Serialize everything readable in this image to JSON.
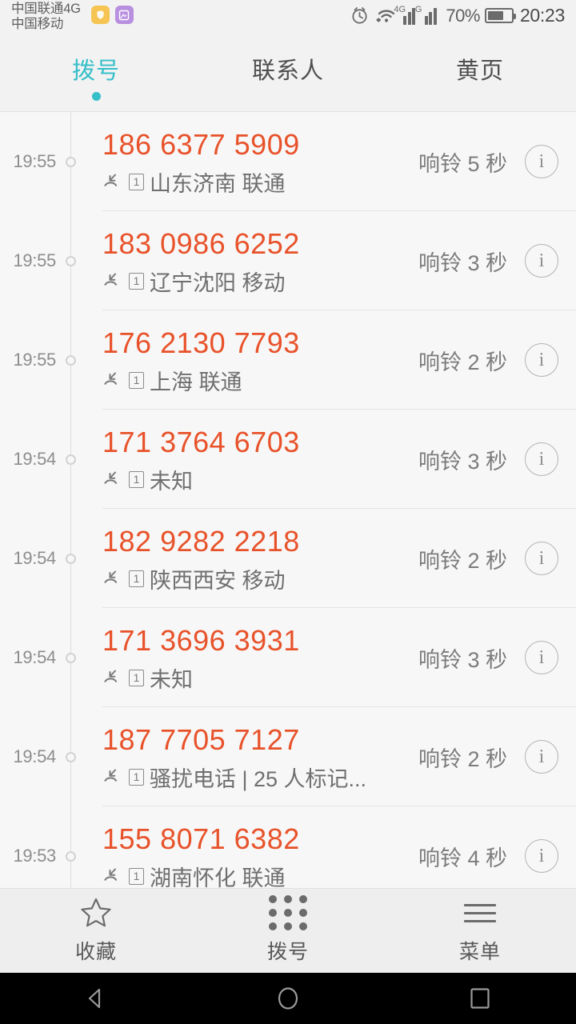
{
  "status_bar": {
    "carriers": [
      "中国联通4G",
      "中国移动"
    ],
    "notification_icons": [
      "shield-app-icon",
      "photo-app-icon"
    ],
    "alarm_icon": "alarm-clock-icon",
    "wifi_icon": "wifi-icon",
    "signal_1_label": "4G",
    "signal_2_label": "G",
    "battery_percent": "70%",
    "clock": "20:23"
  },
  "tabs": [
    {
      "label": "拨号",
      "active": true
    },
    {
      "label": "联系人",
      "active": false
    },
    {
      "label": "黄页",
      "active": false
    }
  ],
  "call_log": [
    {
      "time": "19:55",
      "number": "186 6377 5909",
      "sim": "1",
      "location": "山东济南 联通",
      "duration": "响铃 5 秒",
      "type": "missed"
    },
    {
      "time": "19:55",
      "number": "183 0986 6252",
      "sim": "1",
      "location": "辽宁沈阳 移动",
      "duration": "响铃 3 秒",
      "type": "missed"
    },
    {
      "time": "19:55",
      "number": "176 2130 7793",
      "sim": "1",
      "location": "上海 联通",
      "duration": "响铃 2 秒",
      "type": "missed"
    },
    {
      "time": "19:54",
      "number": "171 3764 6703",
      "sim": "1",
      "location": "未知",
      "duration": "响铃 3 秒",
      "type": "missed"
    },
    {
      "time": "19:54",
      "number": "182 9282 2218",
      "sim": "1",
      "location": "陕西西安 移动",
      "duration": "响铃 2 秒",
      "type": "missed"
    },
    {
      "time": "19:54",
      "number": "171 3696 3931",
      "sim": "1",
      "location": "未知",
      "duration": "响铃 3 秒",
      "type": "missed"
    },
    {
      "time": "19:54",
      "number": "187 7705 7127",
      "sim": "1",
      "location": "骚扰电话 | 25 人标记...",
      "duration": "响铃 2 秒",
      "type": "missed"
    },
    {
      "time": "19:53",
      "number": "155 8071 6382",
      "sim": "1",
      "location": "湖南怀化 联通",
      "duration": "响铃 4 秒",
      "type": "missed"
    }
  ],
  "toolbar": [
    {
      "label": "收藏",
      "icon": "star-icon"
    },
    {
      "label": "拨号",
      "icon": "dialpad-icon"
    },
    {
      "label": "菜单",
      "icon": "hamburger-menu-icon"
    }
  ],
  "nav_bar": [
    {
      "icon": "back-triangle-icon"
    },
    {
      "icon": "home-circle-icon"
    },
    {
      "icon": "recents-square-icon"
    }
  ],
  "info_button_label": "i",
  "colors": {
    "accent_teal": "#35bfc9",
    "number_orange": "#e8522a",
    "text_gray": "#6f6f6f",
    "page_bg": "#f7f7f7",
    "bar_bg": "#f2f2f2"
  }
}
